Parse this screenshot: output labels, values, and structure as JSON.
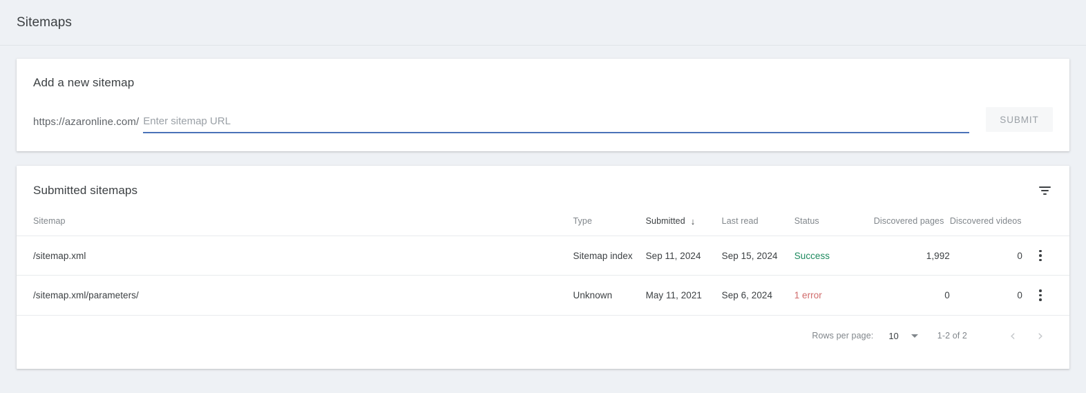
{
  "page": {
    "title": "Sitemaps"
  },
  "add_sitemap": {
    "title": "Add a new sitemap",
    "url_prefix": "https://azaronline.com/",
    "input_value": "",
    "input_placeholder": "Enter sitemap URL",
    "submit_label": "SUBMIT"
  },
  "submitted": {
    "title": "Submitted sitemaps",
    "filter_icon": "filter-icon",
    "columns": [
      {
        "key": "sitemap",
        "label": "Sitemap",
        "sorted": false
      },
      {
        "key": "type",
        "label": "Type",
        "sorted": false
      },
      {
        "key": "submitted",
        "label": "Submitted",
        "sorted": true,
        "sort_arrow": "↓"
      },
      {
        "key": "last_read",
        "label": "Last read",
        "sorted": false
      },
      {
        "key": "status",
        "label": "Status",
        "sorted": false
      },
      {
        "key": "discovered_pages",
        "label": "Discovered pages",
        "sorted": false
      },
      {
        "key": "discovered_videos",
        "label": "Discovered videos",
        "sorted": false
      }
    ],
    "rows": [
      {
        "sitemap": "/sitemap.xml",
        "type": "Sitemap index",
        "submitted": "Sep 11, 2024",
        "last_read": "Sep 15, 2024",
        "status": "Success",
        "status_kind": "success",
        "discovered_pages": "1,992",
        "discovered_videos": "0"
      },
      {
        "sitemap": "/sitemap.xml/parameters/",
        "type": "Unknown",
        "submitted": "May 11, 2021",
        "last_read": "Sep 6, 2024",
        "status": "1 error",
        "status_kind": "error",
        "discovered_pages": "0",
        "discovered_videos": "0"
      }
    ],
    "pagination": {
      "rows_per_page_label": "Rows per page:",
      "rows_per_page_value": "10",
      "range_label": "1-2 of 2",
      "prev_icon": "‹",
      "next_icon": "›"
    }
  },
  "colors": {
    "success": "#1d8a5e",
    "error": "#d06a6a",
    "accent": "#4a72b8",
    "background": "#eef1f5"
  }
}
